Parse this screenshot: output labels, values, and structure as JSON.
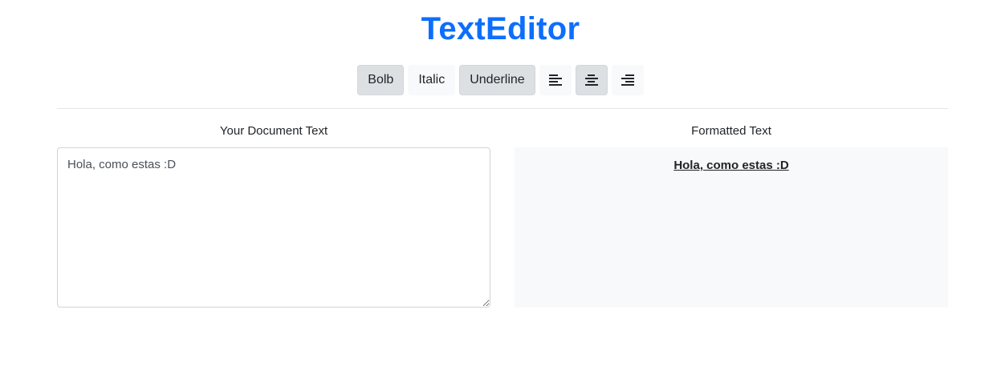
{
  "app": {
    "title": "TextEditor"
  },
  "toolbar": {
    "bold_label": "Bolb",
    "italic_label": "Italic",
    "underline_label": "Underline",
    "active": {
      "bold": true,
      "italic": false,
      "underline": true,
      "align": "center"
    },
    "align_buttons": [
      {
        "icon": "align-left-icon",
        "active": false
      },
      {
        "icon": "align-center-icon",
        "active": true
      },
      {
        "icon": "align-right-icon",
        "active": false
      }
    ]
  },
  "editor": {
    "label": "Your Document Text",
    "value": "Hola, como estas :D"
  },
  "preview": {
    "label": "Formatted Text",
    "text": "Hola, como estas :D"
  },
  "colors": {
    "title": "#0d6efd",
    "active_button": "#dde0e3",
    "preview_background": "#f8f9fa"
  }
}
